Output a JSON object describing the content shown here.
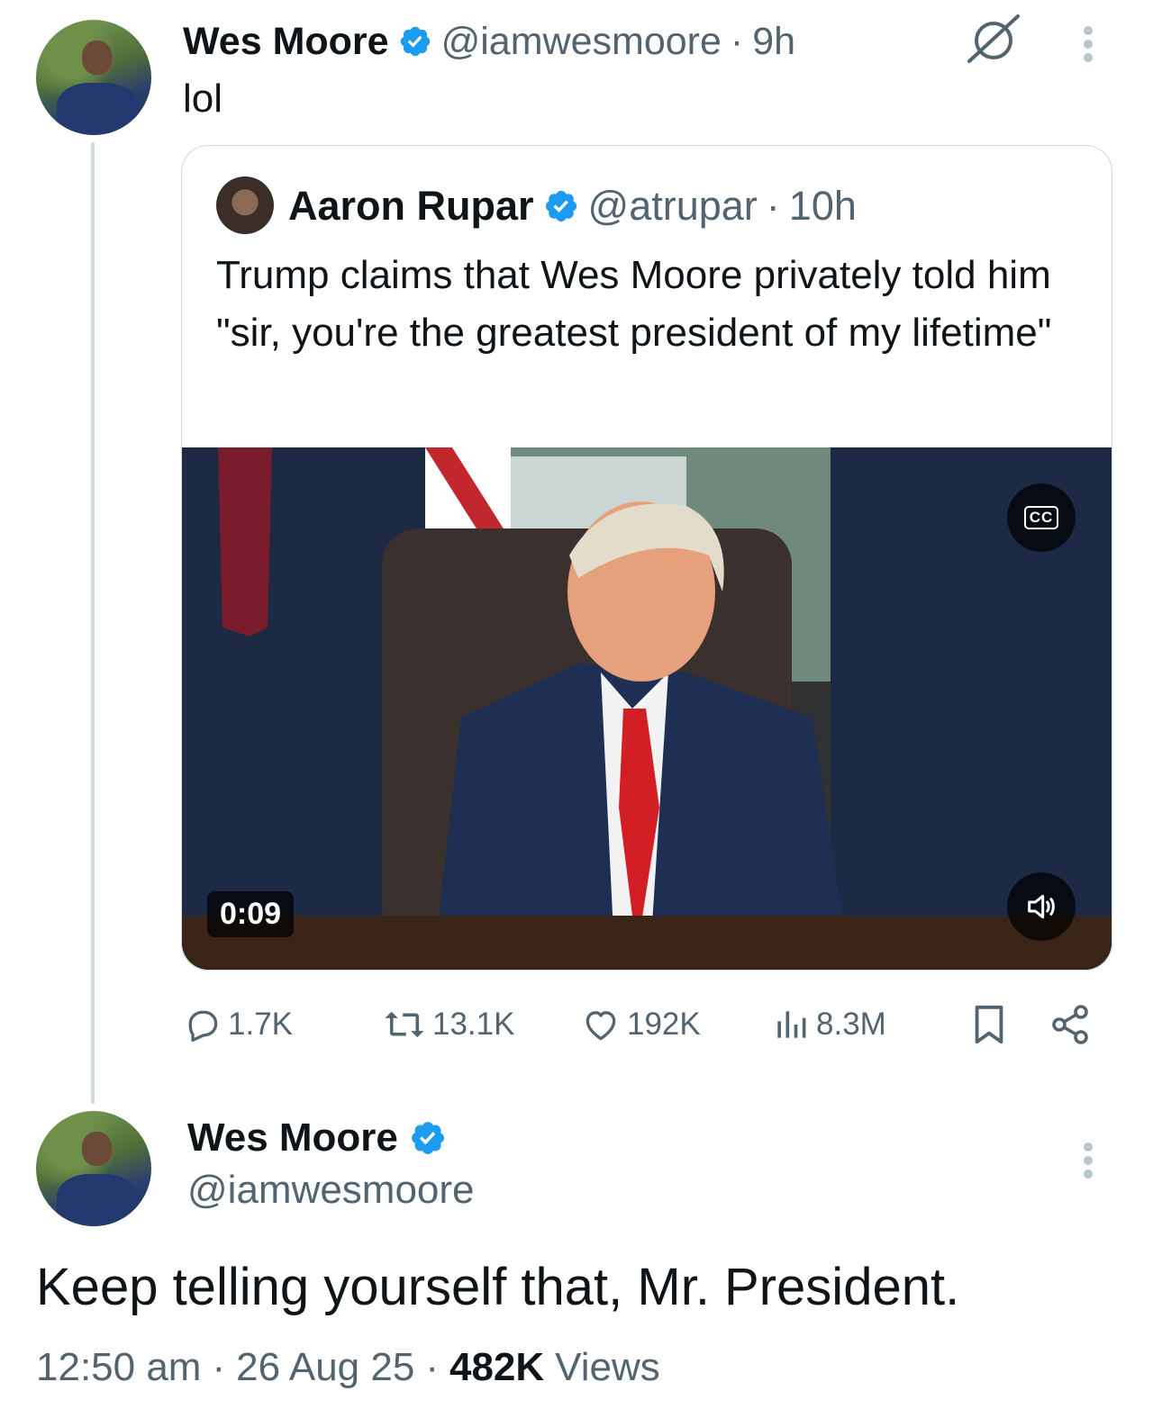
{
  "tweet": {
    "author_name": "Wes Moore",
    "handle": "@iamwesmoore",
    "time": "9h",
    "text": "lol"
  },
  "quote": {
    "author_name": "Aaron Rupar",
    "handle": "@atrupar",
    "time": "10h",
    "text": "Trump claims that Wes Moore privately told him \"sir, you're the greatest president of my lifetime\"",
    "video": {
      "duration": "0:09",
      "cc_label": "CC"
    }
  },
  "actions": {
    "replies": "1.7K",
    "reposts": "13.1K",
    "likes": "192K",
    "views": "8.3M"
  },
  "reply": {
    "author_name": "Wes Moore",
    "handle": "@iamwesmoore",
    "text": "Keep telling yourself that, Mr. President.",
    "time": "12:50 am",
    "date": "26 Aug 25",
    "views_count": "482K",
    "views_label": "Views"
  },
  "colors": {
    "verified": "#1d9bf0",
    "secondary_text": "#536471",
    "divider": "#cfd9de"
  }
}
